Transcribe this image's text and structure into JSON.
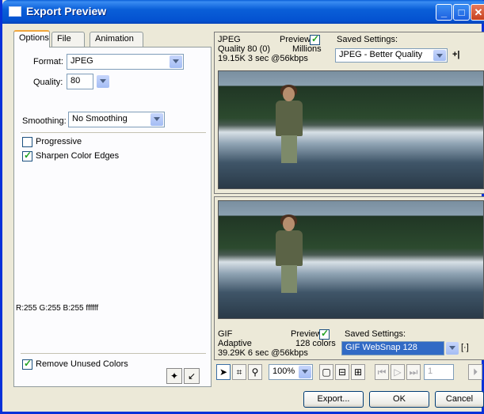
{
  "window": {
    "title": "Export Preview"
  },
  "tabs": [
    "Options",
    "File",
    "Animation"
  ],
  "options": {
    "format_label": "Format:",
    "format_value": "JPEG",
    "quality_label": "Quality:",
    "quality_value": "80",
    "smoothing_label": "Smoothing:",
    "smoothing_value": "No Smoothing",
    "progressive_label": "Progressive",
    "progressive_checked": false,
    "sharpen_label": "Sharpen Color Edges",
    "sharpen_checked": true,
    "color_readout": "R:255 G:255 B:255 ffffff",
    "remove_unused_label": "Remove Unused Colors",
    "remove_unused_checked": true
  },
  "preview_top": {
    "format": "JPEG",
    "preview_label": "Preview",
    "line2": "Quality 80 (0)",
    "colors": "Millions",
    "line3": "19.15K  3 sec @56kbps",
    "saved_label": "Saved Settings:",
    "saved_value": "JPEG - Better Quality",
    "add_button": "+|"
  },
  "preview_bottom": {
    "format": "GIF",
    "preview_label": "Preview",
    "line2": "Adaptive",
    "colors": "128 colors",
    "line3": "39.29K  6 sec @56kbps",
    "saved_label": "Saved Settings:",
    "saved_value": "GIF WebSnap 128"
  },
  "toolbar": {
    "zoom": "100%",
    "frame": "1"
  },
  "buttons": {
    "export": "Export...",
    "ok": "OK",
    "cancel": "Cancel"
  }
}
